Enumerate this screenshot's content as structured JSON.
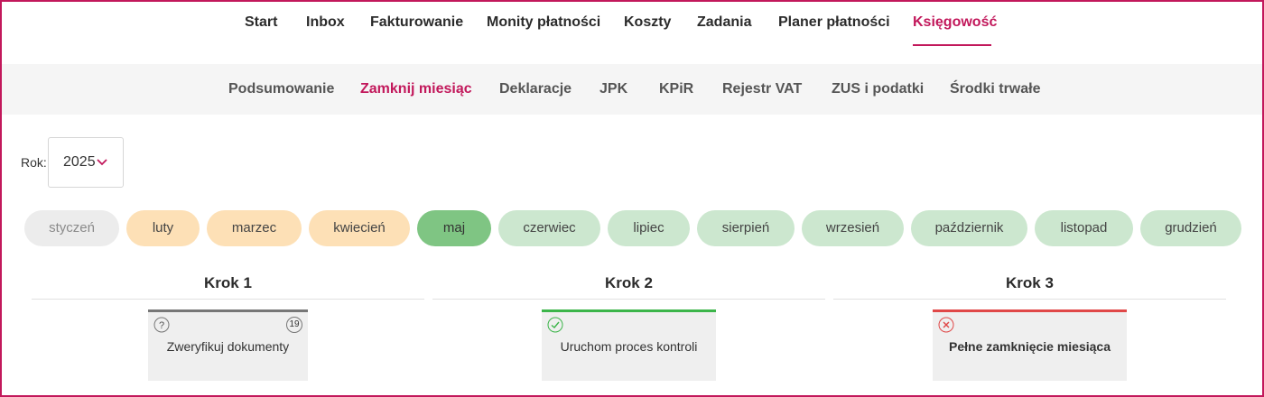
{
  "top_nav": {
    "items": [
      {
        "label": "Start"
      },
      {
        "label": "Inbox"
      },
      {
        "label": "Fakturowanie"
      },
      {
        "label": "Monity płatności"
      },
      {
        "label": "Koszty"
      },
      {
        "label": "Zadania"
      },
      {
        "label": "Planer płatności"
      },
      {
        "label": "Księgowość",
        "active": true
      }
    ]
  },
  "sub_nav": {
    "items": [
      {
        "label": "Podsumowanie"
      },
      {
        "label": "Zamknij miesiąc",
        "active": true
      },
      {
        "label": "Deklaracje"
      },
      {
        "label": "JPK"
      },
      {
        "label": "KPiR"
      },
      {
        "label": "Rejestr VAT"
      },
      {
        "label": "ZUS i podatki"
      },
      {
        "label": "Środki trwałe"
      }
    ]
  },
  "year": {
    "label": "Rok:",
    "value": "2025",
    "icon": "chevron-down-icon"
  },
  "months": [
    {
      "label": "styczeń",
      "status": "gray"
    },
    {
      "label": "luty",
      "status": "orange"
    },
    {
      "label": "marzec",
      "status": "orange"
    },
    {
      "label": "kwiecień",
      "status": "orange"
    },
    {
      "label": "maj",
      "status": "green"
    },
    {
      "label": "czerwiec",
      "status": "lightgreen"
    },
    {
      "label": "lipiec",
      "status": "lightgreen"
    },
    {
      "label": "sierpień",
      "status": "lightgreen"
    },
    {
      "label": "wrzesień",
      "status": "lightgreen"
    },
    {
      "label": "październik",
      "status": "lightgreen"
    },
    {
      "label": "listopad",
      "status": "lightgreen"
    },
    {
      "label": "grudzień",
      "status": "lightgreen"
    }
  ],
  "steps": [
    {
      "title": "Krok 1",
      "card_label": "Zweryfikuj dokumenty",
      "status_icon": "question-icon",
      "bar_color": "#777777",
      "count": "19"
    },
    {
      "title": "Krok 2",
      "card_label": "Uruchom proces kontroli",
      "status_icon": "check-circle-icon",
      "bar_color": "#3cb54a"
    },
    {
      "title": "Krok 3",
      "card_label": "Pełne zamknięcie miesiąca",
      "status_icon": "x-circle-icon",
      "bar_color": "#e04848"
    }
  ],
  "colors": {
    "accent": "#c2185b"
  }
}
